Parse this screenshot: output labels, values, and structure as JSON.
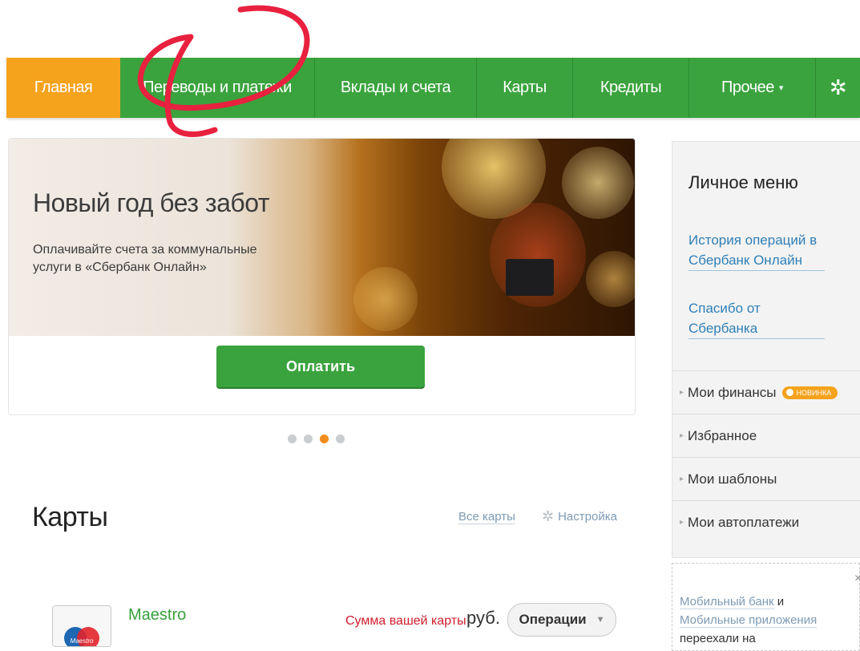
{
  "nav": {
    "items": [
      {
        "label": "Главная",
        "active": true
      },
      {
        "label": "Переводы и платежи"
      },
      {
        "label": "Вклады и счета"
      },
      {
        "label": "Карты"
      },
      {
        "label": "Кредиты"
      },
      {
        "label": "Прочее"
      }
    ],
    "more_caret": "▾",
    "settings_icon": "gear-icon",
    "active_color": "#f5a21d",
    "bar_color": "#3aa33d"
  },
  "annotation": {
    "color": "#e8213f",
    "shape": "hand-drawn circle around nav item"
  },
  "promo": {
    "title": "Новый год без забот",
    "text": "Оплачивайте счета за коммунальные услуги в «Сбербанк Онлайн»",
    "button_label": "Оплатить",
    "carousel": {
      "count": 4,
      "active_index": 2
    }
  },
  "cards": {
    "heading": "Карты",
    "all_cards_link": "Все карты",
    "settings_link": "Настройка",
    "items": [
      {
        "name": "Maestro",
        "brand_text": "Maestro",
        "sum_label": "Сумма вашей карты",
        "currency": "руб.",
        "operations_label": "Операции"
      }
    ]
  },
  "sidebar": {
    "title": "Личное меню",
    "links": [
      "История операций в Сбербанк Онлайн",
      "Спасибо от Сбербанка"
    ],
    "items": [
      {
        "label": "Мои финансы",
        "badge": "НОВИНКА"
      },
      {
        "label": "Избранное"
      },
      {
        "label": "Мои шаблоны"
      },
      {
        "label": "Мои автоплатежи"
      }
    ],
    "mobile_note": {
      "link1": "Мобильный банк",
      "and": " и ",
      "link2": "Мобильные приложения",
      "tail": " переехали на",
      "close": "×"
    }
  }
}
